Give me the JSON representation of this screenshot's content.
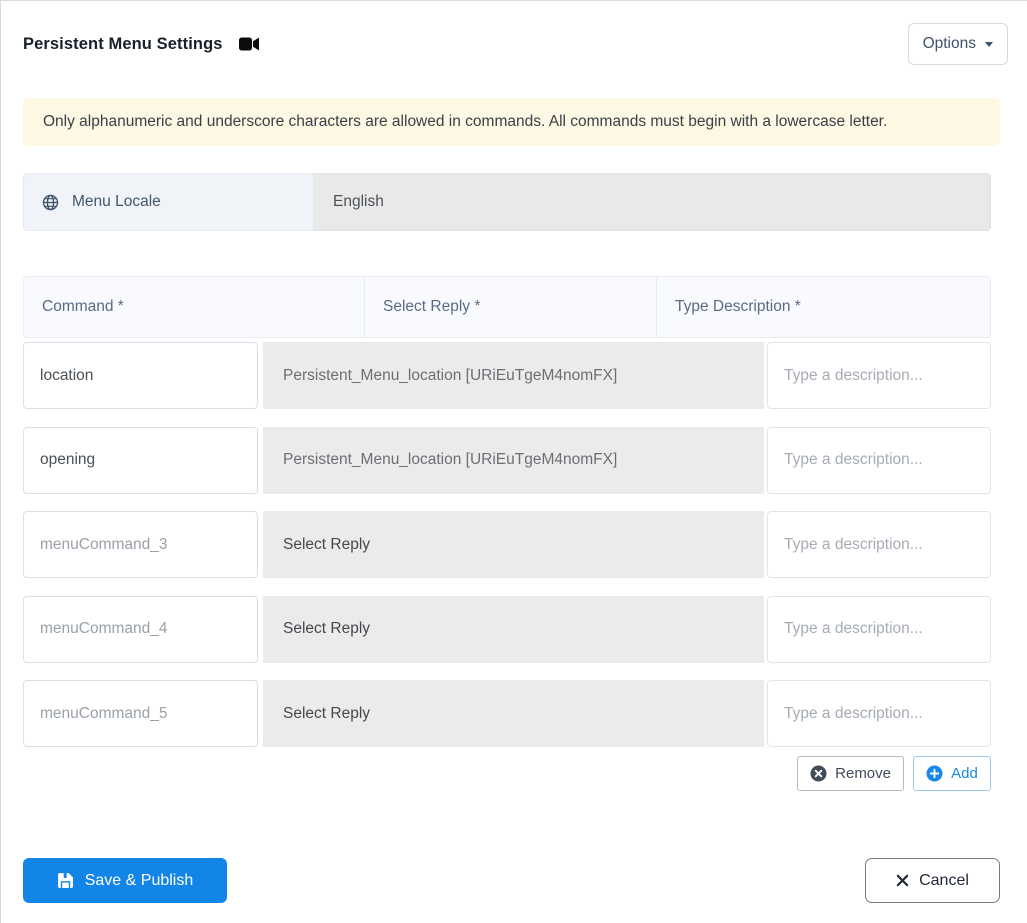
{
  "header": {
    "title": "Persistent Menu Settings",
    "options_button": "Options"
  },
  "alert": {
    "message": "Only alphanumeric and underscore characters are allowed in commands. All commands must begin with a lowercase letter."
  },
  "locale": {
    "label": "Menu Locale",
    "value": "English"
  },
  "commands_table": {
    "columns": [
      "Command *",
      "Select Reply *",
      "Type Description *"
    ],
    "rows": [
      {
        "command_value": "location",
        "command_placeholder": "",
        "reply": "Persistent_Menu_location [URiEuTgeM4nomFX]",
        "reply_state": "selected",
        "description_value": "",
        "description_placeholder": "Type a description..."
      },
      {
        "command_value": "opening",
        "command_placeholder": "",
        "reply": "Persistent_Menu_location [URiEuTgeM4nomFX]",
        "reply_state": "selected",
        "description_value": "",
        "description_placeholder": "Type a description..."
      },
      {
        "command_value": "",
        "command_placeholder": "menuCommand_3",
        "reply": "Select Reply",
        "reply_state": "empty",
        "description_value": "",
        "description_placeholder": "Type a description..."
      },
      {
        "command_value": "",
        "command_placeholder": "menuCommand_4",
        "reply": "Select Reply",
        "reply_state": "empty",
        "description_value": "",
        "description_placeholder": "Type a description..."
      },
      {
        "command_value": "",
        "command_placeholder": "menuCommand_5",
        "reply": "Select Reply",
        "reply_state": "empty",
        "description_value": "",
        "description_placeholder": "Type a description..."
      }
    ],
    "remove_button": "Remove",
    "add_button": "Add"
  },
  "footer": {
    "save_button": "Save & Publish",
    "cancel_button": "Cancel"
  },
  "icons": {
    "title_icon": "video-camera-icon",
    "locale_icon": "globe-icon",
    "options_icon": "caret-down-icon",
    "remove_icon": "x-circle-icon",
    "add_icon": "plus-circle-icon",
    "save_icon": "floppy-save-icon",
    "cancel_icon": "x-icon"
  },
  "colors": {
    "primary_blue": "#1385e8",
    "alert_bg": "#fcf8e3",
    "table_header_bg": "#f8fafd",
    "reply_cell_bg": "#ebebeb",
    "locale_label_bg": "#f0f4f9",
    "locale_value_bg": "#e9e9e9",
    "add_border": "#9dc9f0"
  }
}
